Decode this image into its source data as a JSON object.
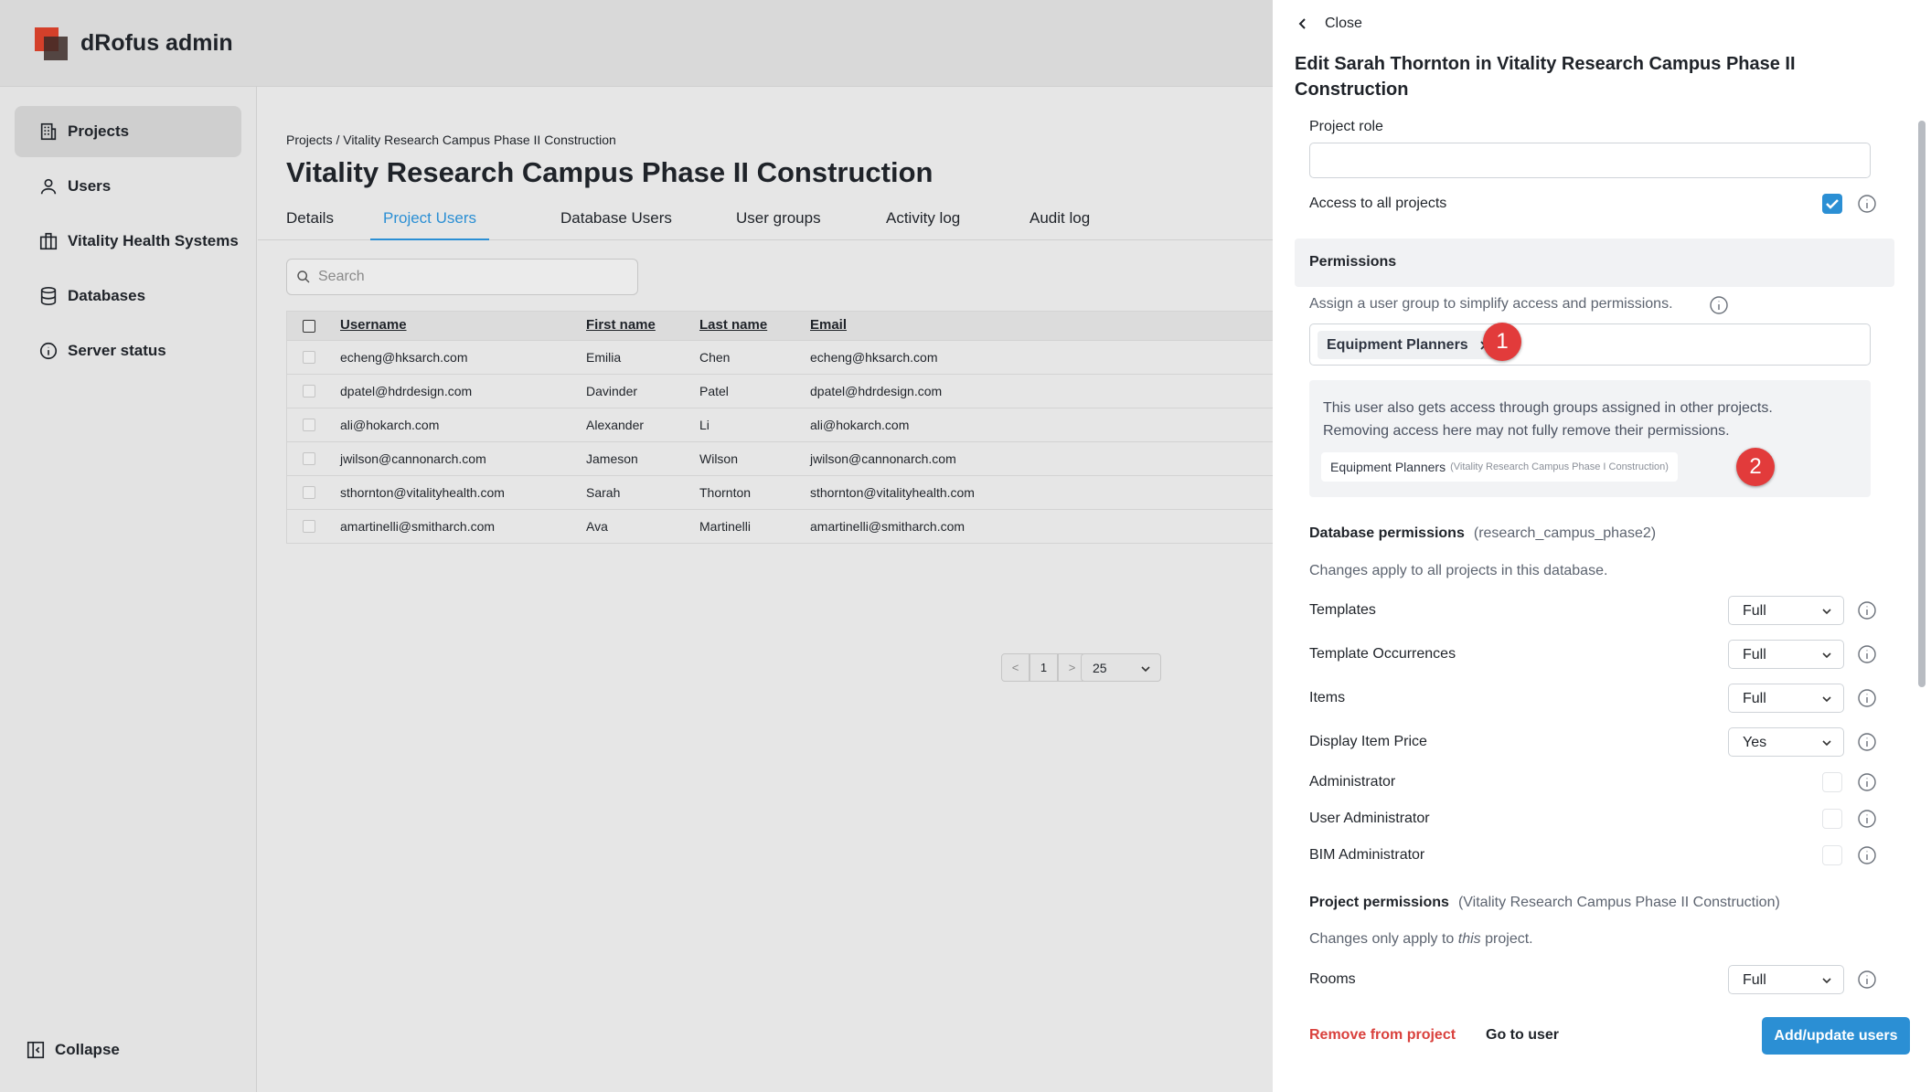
{
  "app": {
    "title": "dRofus admin"
  },
  "sidebar": {
    "items": [
      {
        "label": "Projects",
        "icon": "building-icon"
      },
      {
        "label": "Users",
        "icon": "user-icon"
      },
      {
        "label": "Vitality Health Systems",
        "icon": "organization-icon"
      },
      {
        "label": "Databases",
        "icon": "database-icon"
      },
      {
        "label": "Server status",
        "icon": "info-icon"
      }
    ],
    "collapse_label": "Collapse"
  },
  "main": {
    "breadcrumb": "Projects / Vitality Research Campus Phase II Construction",
    "title": "Vitality Research Campus Phase II Construction",
    "tabs": [
      {
        "label": "Details"
      },
      {
        "label": "Project Users",
        "active": true
      },
      {
        "label": "Database Users"
      },
      {
        "label": "User groups"
      },
      {
        "label": "Activity log"
      },
      {
        "label": "Audit log"
      }
    ],
    "search": {
      "placeholder": "Search",
      "value": ""
    },
    "table": {
      "columns": [
        "Username",
        "First name",
        "Last name",
        "Email"
      ],
      "rows": [
        [
          "echeng@hksarch.com",
          "Emilia",
          "Chen",
          "echeng@hksarch.com"
        ],
        [
          "dpatel@hdrdesign.com",
          "Davinder",
          "Patel",
          "dpatel@hdrdesign.com"
        ],
        [
          "ali@hokarch.com",
          "Alexander",
          "Li",
          "ali@hokarch.com"
        ],
        [
          "jwilson@cannonarch.com",
          "Jameson",
          "Wilson",
          "jwilson@cannonarch.com"
        ],
        [
          "sthornton@vitalityhealth.com",
          "Sarah",
          "Thornton",
          "sthornton@vitalityhealth.com"
        ],
        [
          "amartinelli@smitharch.com",
          "Ava",
          "Martinelli",
          "amartinelli@smitharch.com"
        ]
      ]
    },
    "pagination": {
      "prev": "<",
      "page": "1",
      "next": ">",
      "page_size": "25"
    }
  },
  "drawer": {
    "close_label": "Close",
    "title": "Edit Sarah Thornton in Vitality Research Campus Phase II Construction",
    "project_role": {
      "label": "Project role",
      "value": ""
    },
    "access_all": {
      "label": "Access to all projects",
      "checked": true
    },
    "permissions": {
      "header": "Permissions",
      "hint": "Assign a user group to simplify access and permissions.",
      "chip": "Equipment Planners",
      "marker1": "1",
      "notice_line1": "This user also gets access through groups assigned in other projects.",
      "notice_line2": "Removing access here may not fully remove their permissions.",
      "other_group": "Equipment Planners",
      "other_group_project": "(Vitality Research Campus Phase I Construction)",
      "marker2": "2"
    },
    "database_permissions": {
      "title": "Database permissions",
      "db": "(research_campus_phase2)",
      "note": "Changes apply to all projects in this database.",
      "selects": [
        {
          "label": "Templates",
          "value": "Full"
        },
        {
          "label": "Template Occurrences",
          "value": "Full"
        },
        {
          "label": "Items",
          "value": "Full"
        },
        {
          "label": "Display Item Price",
          "value": "Yes"
        }
      ],
      "checks": [
        {
          "label": "Administrator",
          "checked": false
        },
        {
          "label": "User Administrator",
          "checked": false
        },
        {
          "label": "BIM Administrator",
          "checked": false
        }
      ]
    },
    "project_permissions": {
      "title": "Project permissions",
      "project": "(Vitality Research Campus Phase II Construction)",
      "note_prefix": "Changes only apply to ",
      "note_em": "this",
      "note_suffix": " project.",
      "selects": [
        {
          "label": "Rooms",
          "value": "Full"
        }
      ]
    },
    "footer": {
      "remove": "Remove from project",
      "goto": "Go to user",
      "primary": "Add/update users"
    },
    "colors": {
      "accent": "#2b8fd4",
      "danger": "#d9413d",
      "marker": "#e23b3b"
    }
  }
}
